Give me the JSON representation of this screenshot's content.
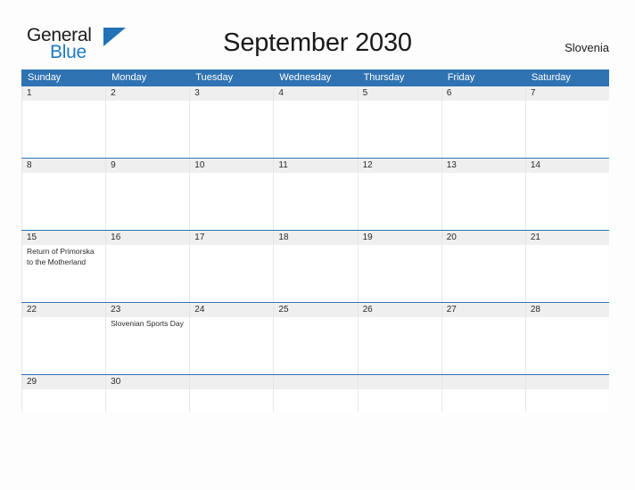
{
  "brand": {
    "name_part1": "General",
    "name_part2": "Blue",
    "triangle_color": "#2272b5",
    "blue_color": "#1f7ac4"
  },
  "header": {
    "title": "September 2030",
    "country": "Slovenia"
  },
  "theme": {
    "header_blue": "#2f73b3",
    "date_band": "#efefef",
    "page_background": "#fdfdfd",
    "cell_border": "#e6e6e6"
  },
  "calendar": {
    "weekdays": [
      "Sunday",
      "Monday",
      "Tuesday",
      "Wednesday",
      "Thursday",
      "Friday",
      "Saturday"
    ],
    "weeks": [
      {
        "days": [
          {
            "number": "1",
            "events": []
          },
          {
            "number": "2",
            "events": []
          },
          {
            "number": "3",
            "events": []
          },
          {
            "number": "4",
            "events": []
          },
          {
            "number": "5",
            "events": []
          },
          {
            "number": "6",
            "events": []
          },
          {
            "number": "7",
            "events": []
          }
        ]
      },
      {
        "days": [
          {
            "number": "8",
            "events": []
          },
          {
            "number": "9",
            "events": []
          },
          {
            "number": "10",
            "events": []
          },
          {
            "number": "11",
            "events": []
          },
          {
            "number": "12",
            "events": []
          },
          {
            "number": "13",
            "events": []
          },
          {
            "number": "14",
            "events": []
          }
        ]
      },
      {
        "days": [
          {
            "number": "15",
            "events": [
              "Return of Primorska to the Motherland"
            ]
          },
          {
            "number": "16",
            "events": []
          },
          {
            "number": "17",
            "events": []
          },
          {
            "number": "18",
            "events": []
          },
          {
            "number": "19",
            "events": []
          },
          {
            "number": "20",
            "events": []
          },
          {
            "number": "21",
            "events": []
          }
        ]
      },
      {
        "days": [
          {
            "number": "22",
            "events": []
          },
          {
            "number": "23",
            "events": [
              "Slovenian Sports Day"
            ]
          },
          {
            "number": "24",
            "events": []
          },
          {
            "number": "25",
            "events": []
          },
          {
            "number": "26",
            "events": []
          },
          {
            "number": "27",
            "events": []
          },
          {
            "number": "28",
            "events": []
          }
        ]
      },
      {
        "short": true,
        "days": [
          {
            "number": "29",
            "events": []
          },
          {
            "number": "30",
            "events": []
          },
          {
            "number": "",
            "events": []
          },
          {
            "number": "",
            "events": []
          },
          {
            "number": "",
            "events": []
          },
          {
            "number": "",
            "events": []
          },
          {
            "number": "",
            "events": []
          }
        ]
      }
    ]
  }
}
